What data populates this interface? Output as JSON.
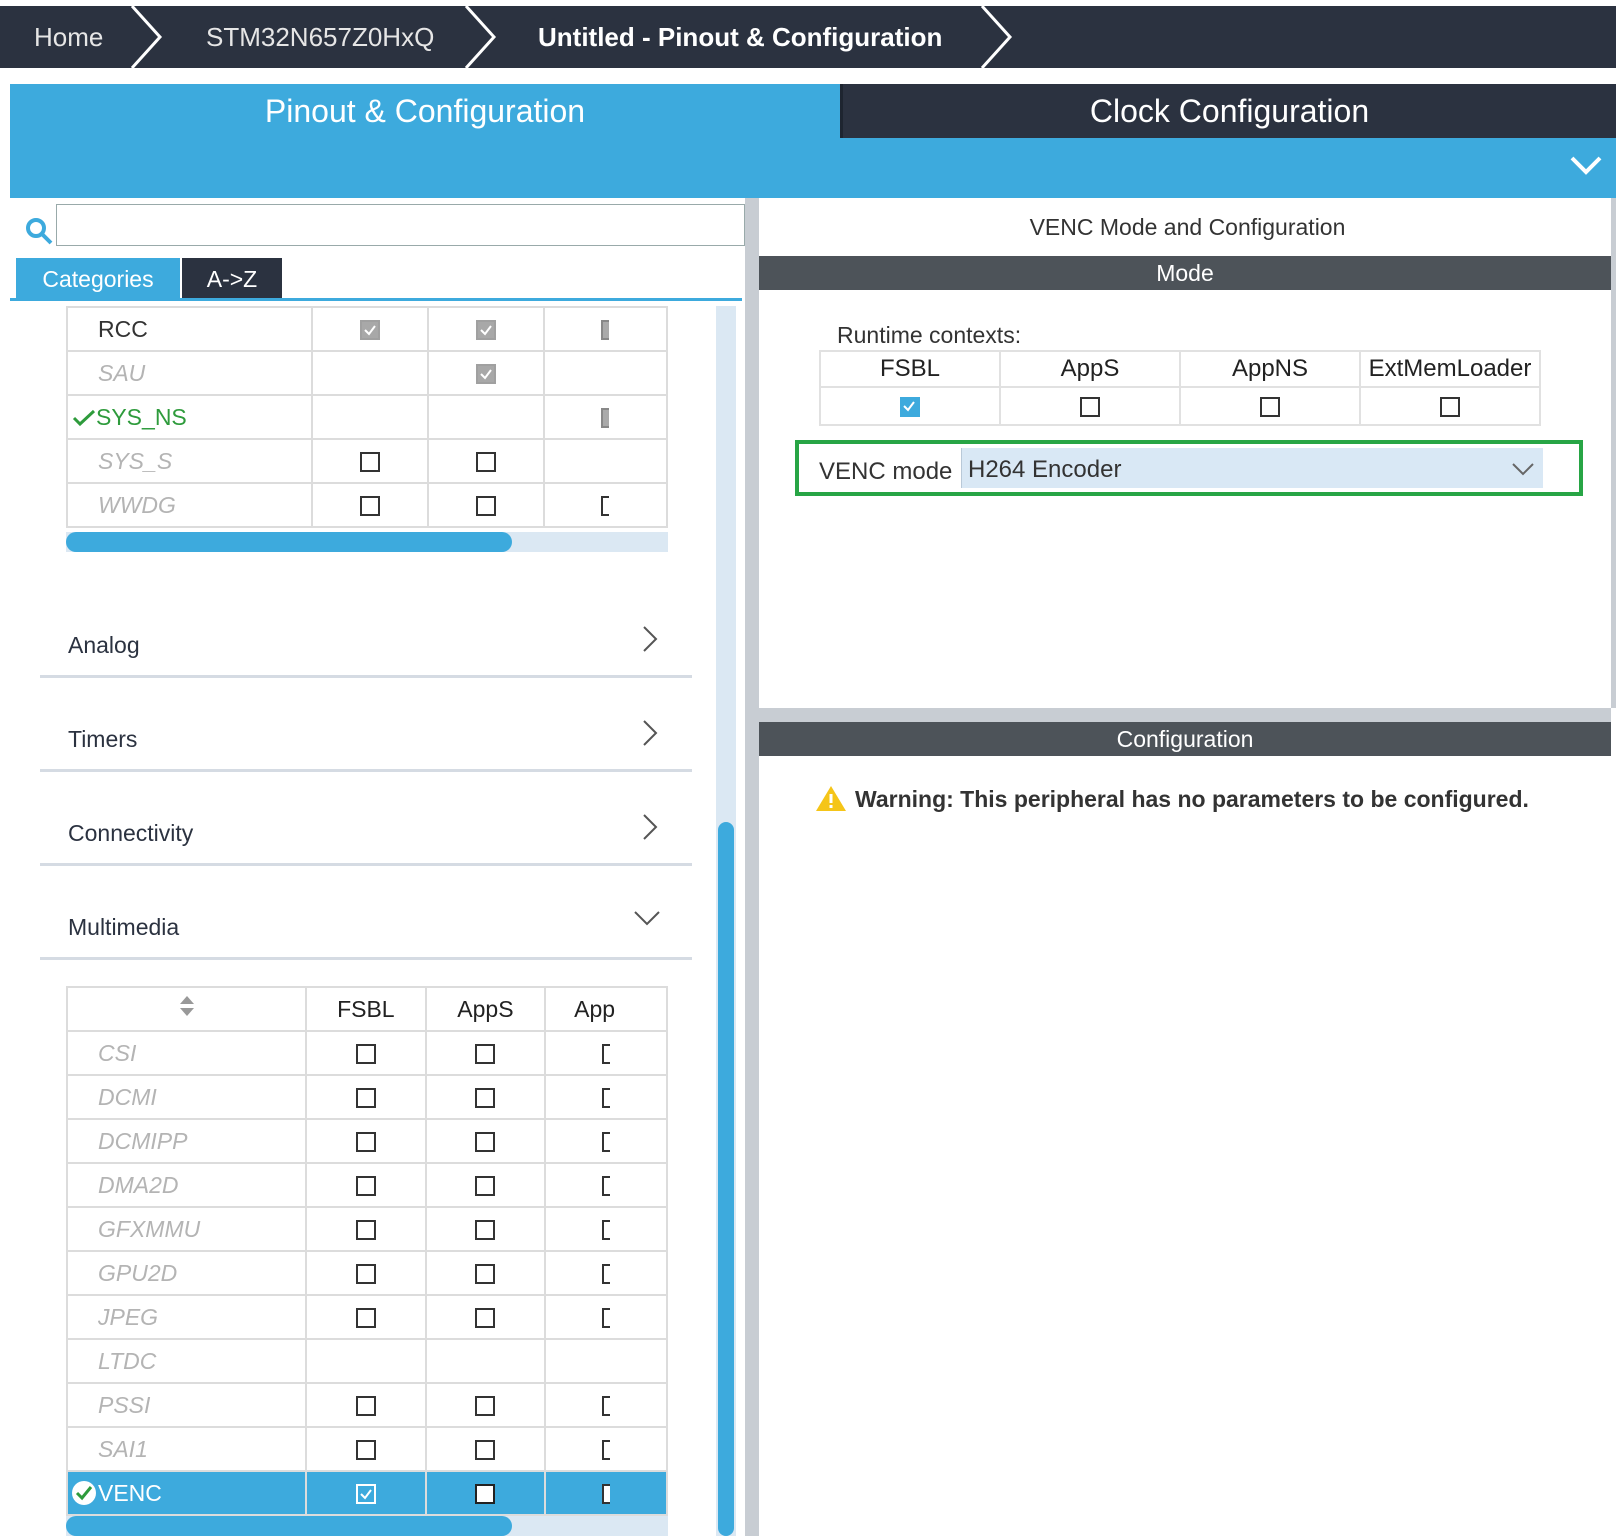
{
  "breadcrumb": {
    "items": [
      "Home",
      "STM32N657Z0HxQ",
      "Untitled - Pinout & Configuration"
    ]
  },
  "tabs": {
    "pinout": "Pinout & Configuration",
    "clock": "Clock Configuration"
  },
  "search": {
    "value": "",
    "placeholder": ""
  },
  "view_tabs": {
    "categories": "Categories",
    "az": "A->Z"
  },
  "system_core_rows": [
    {
      "name": "RCC",
      "style": "normal",
      "fsbl": "grey-check",
      "apps": "grey-check",
      "appns": "partial"
    },
    {
      "name": "SAU",
      "style": "ital",
      "fsbl": "none",
      "apps": "grey-check",
      "appns": "none"
    },
    {
      "name": "SYS_NS",
      "style": "green",
      "fsbl": "none",
      "apps": "none",
      "appns": "partial"
    },
    {
      "name": "SYS_S",
      "style": "ital",
      "fsbl": "empty",
      "apps": "empty",
      "appns": "none"
    },
    {
      "name": "WWDG",
      "style": "ital",
      "fsbl": "empty",
      "apps": "empty",
      "appns": "bracket"
    }
  ],
  "categories": [
    {
      "label": "Analog",
      "expanded": false
    },
    {
      "label": "Timers",
      "expanded": false
    },
    {
      "label": "Connectivity",
      "expanded": false
    },
    {
      "label": "Multimedia",
      "expanded": true
    }
  ],
  "multimedia": {
    "columns": [
      "FSBL",
      "AppS",
      "App"
    ],
    "rows": [
      {
        "name": "CSI",
        "fsbl": "empty",
        "apps": "empty",
        "appns": "bracket"
      },
      {
        "name": "DCMI",
        "fsbl": "empty",
        "apps": "empty",
        "appns": "bracket"
      },
      {
        "name": "DCMIPP",
        "fsbl": "empty",
        "apps": "empty",
        "appns": "bracket"
      },
      {
        "name": "DMA2D",
        "fsbl": "empty",
        "apps": "empty",
        "appns": "bracket"
      },
      {
        "name": "GFXMMU",
        "fsbl": "empty",
        "apps": "empty",
        "appns": "bracket"
      },
      {
        "name": "GPU2D",
        "fsbl": "empty",
        "apps": "empty",
        "appns": "bracket"
      },
      {
        "name": "JPEG",
        "fsbl": "empty",
        "apps": "empty",
        "appns": "bracket"
      },
      {
        "name": "LTDC",
        "fsbl": "none",
        "apps": "none",
        "appns": "none"
      },
      {
        "name": "PSSI",
        "fsbl": "empty",
        "apps": "empty",
        "appns": "bracket"
      },
      {
        "name": "SAI1",
        "fsbl": "empty",
        "apps": "empty",
        "appns": "bracket"
      },
      {
        "name": "VENC",
        "fsbl": "checked",
        "apps": "empty",
        "appns": "bracket",
        "selected": true
      }
    ]
  },
  "right_panel": {
    "title": "VENC Mode and Configuration",
    "mode_header": "Mode",
    "runtime_label": "Runtime contexts:",
    "contexts": [
      {
        "label": "FSBL",
        "checked": true
      },
      {
        "label": "AppS",
        "checked": false
      },
      {
        "label": "AppNS",
        "checked": false
      },
      {
        "label": "ExtMemLoader",
        "checked": false
      }
    ],
    "venc_mode_label": "VENC mode",
    "venc_mode_value": "H264 Encoder",
    "config_header": "Configuration",
    "warning": "Warning: This peripheral has no parameters to be configured."
  },
  "colors": {
    "accent": "#3daadd",
    "dark": "#2b3240",
    "highlight_box": "#27a545",
    "enabled_text": "#2e9b3c"
  }
}
